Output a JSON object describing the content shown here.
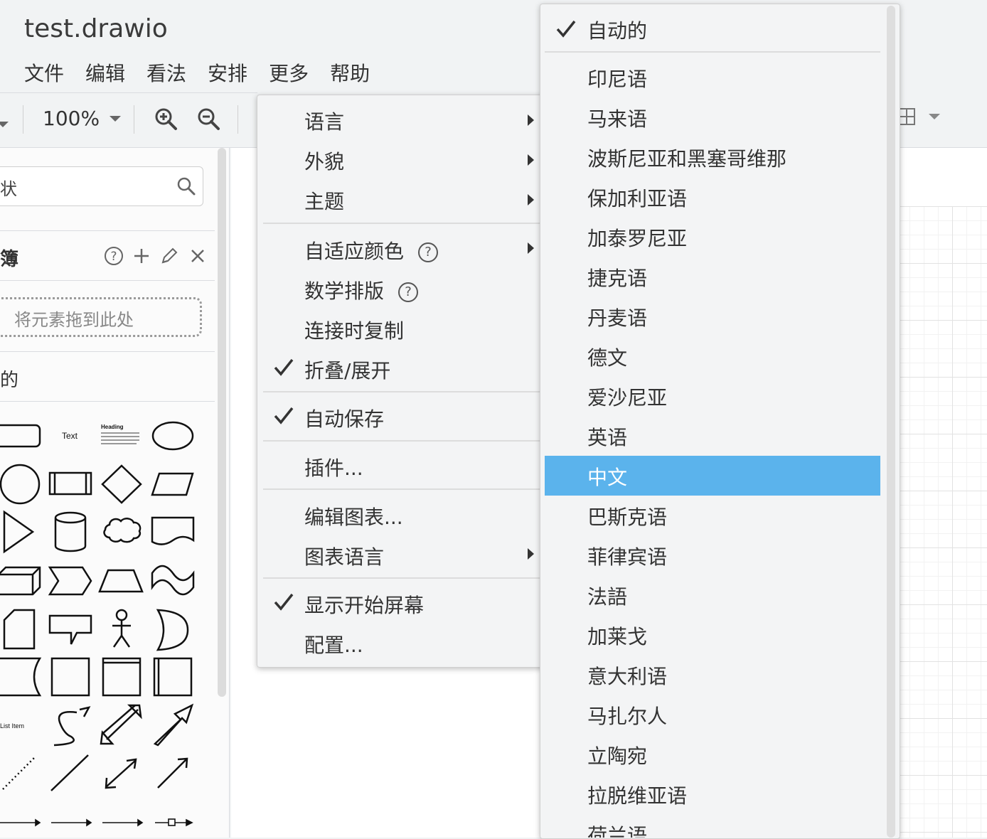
{
  "app": {
    "title": "test.drawio",
    "menus": [
      "文件",
      "编辑",
      "看法",
      "安排",
      "更多",
      "帮助"
    ]
  },
  "toolbar": {
    "zoom_level": "100%"
  },
  "sidebar": {
    "search_placeholder": "状",
    "scratchpad_label": "簿",
    "drop_zone_text": "将元素拖到此处",
    "general_label": "的",
    "shape_labels": {
      "text": "Text",
      "heading": "Heading",
      "list_item": "List Item"
    }
  },
  "main_menu": {
    "items": [
      {
        "label": "语言",
        "submenu": true,
        "checked": false
      },
      {
        "label": "外貌",
        "submenu": true,
        "checked": false
      },
      {
        "label": "主题",
        "submenu": true,
        "checked": false
      },
      {
        "label": "自适应颜色",
        "submenu": true,
        "checked": false,
        "help": true
      },
      {
        "label": "数学排版",
        "submenu": false,
        "checked": false,
        "help": true
      },
      {
        "label": "连接时复制",
        "submenu": false,
        "checked": false
      },
      {
        "label": "折叠/展开",
        "submenu": false,
        "checked": true
      },
      {
        "label": "自动保存",
        "submenu": false,
        "checked": true
      },
      {
        "label": "插件...",
        "submenu": false,
        "checked": false
      },
      {
        "label": "编辑图表...",
        "submenu": false,
        "checked": false
      },
      {
        "label": "图表语言",
        "submenu": true,
        "checked": false
      },
      {
        "label": "显示开始屏幕",
        "submenu": false,
        "checked": true
      },
      {
        "label": "配置...",
        "submenu": false,
        "checked": false
      }
    ]
  },
  "language_menu": {
    "items": [
      {
        "label": "自动的",
        "checked": true
      },
      {
        "label": "印尼语"
      },
      {
        "label": "马来语"
      },
      {
        "label": "波斯尼亚和黑塞哥维那"
      },
      {
        "label": "保加利亚语"
      },
      {
        "label": "加泰罗尼亚"
      },
      {
        "label": "捷克语"
      },
      {
        "label": "丹麦语"
      },
      {
        "label": "德文"
      },
      {
        "label": "爱沙尼亚"
      },
      {
        "label": "英语"
      },
      {
        "label": "中文",
        "highlighted": true
      },
      {
        "label": "巴斯克语"
      },
      {
        "label": "菲律宾语"
      },
      {
        "label": "法語"
      },
      {
        "label": "加莱戈"
      },
      {
        "label": "意大利语"
      },
      {
        "label": "马扎尔人"
      },
      {
        "label": "立陶宛"
      },
      {
        "label": "拉脱维亚语"
      },
      {
        "label": "荷兰语"
      }
    ]
  },
  "colors": {
    "highlight": "#5bb3ec",
    "menu_bg": "#f3f4f5",
    "chrome_bg": "#f1f3f4"
  }
}
